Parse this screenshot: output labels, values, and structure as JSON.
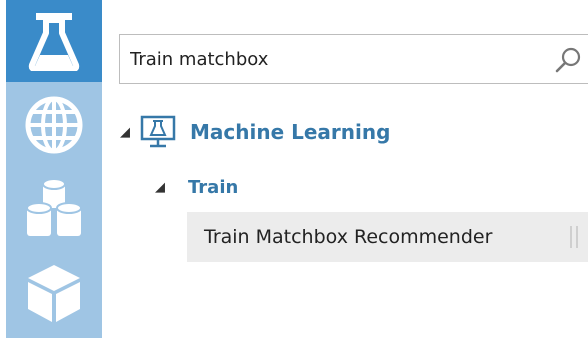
{
  "left_rail": {
    "items": [
      {
        "icon": "flask-icon",
        "active": true
      },
      {
        "icon": "globe-icon",
        "active": false
      },
      {
        "icon": "datasets-icon",
        "active": false
      },
      {
        "icon": "cube-icon",
        "active": false
      }
    ],
    "colors": {
      "rail": "#9fc5e4",
      "active": "#3a8bc9"
    }
  },
  "search": {
    "value": "Train matchbox",
    "icon": "search-icon"
  },
  "tree": {
    "category": {
      "label": "Machine Learning",
      "icon": "ml-monitor-icon",
      "expanded": true
    },
    "subcategory": {
      "label": "Train",
      "expanded": true
    },
    "modules": [
      {
        "label": "Train Matchbox Recommender",
        "selected": true
      }
    ]
  },
  "colors": {
    "accent": "#3678a8",
    "selected_row": "#ececec"
  }
}
